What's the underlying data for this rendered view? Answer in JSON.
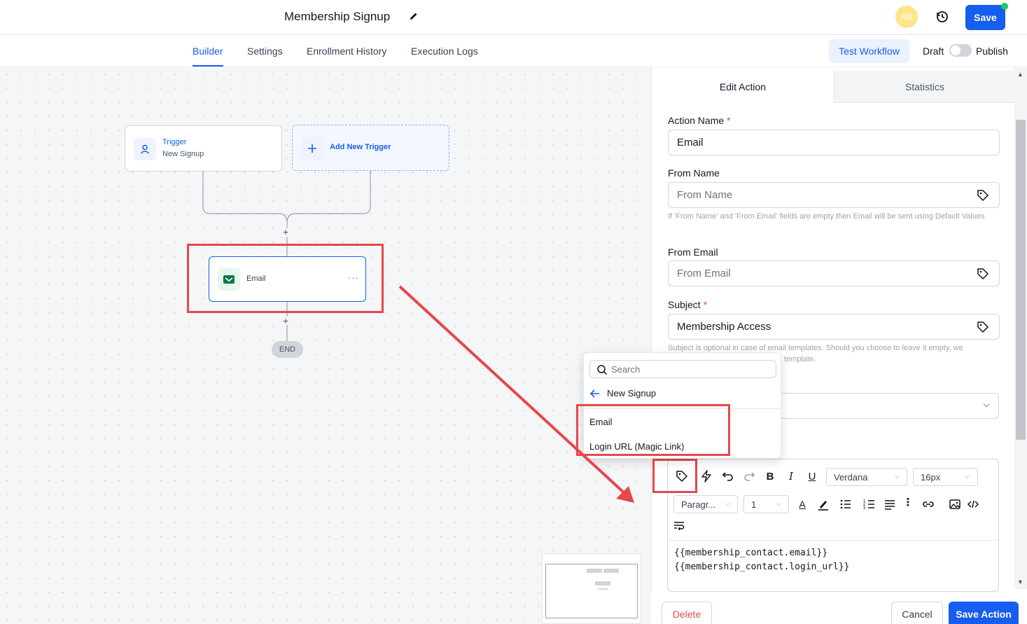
{
  "header": {
    "title": "Membership Signup",
    "avatar_initials": "AB",
    "save_label": "Save"
  },
  "tabs": [
    {
      "label": "Builder",
      "active": true
    },
    {
      "label": "Settings",
      "active": false
    },
    {
      "label": "Enrollment History",
      "active": false
    },
    {
      "label": "Execution Logs",
      "active": false
    }
  ],
  "toolbar": {
    "test_label": "Test Workflow",
    "draft_label": "Draft",
    "publish_label": "Publish",
    "publish_enabled": false
  },
  "canvas": {
    "trigger": {
      "title": "Trigger",
      "subtitle": "New Signup"
    },
    "add_trigger": {
      "label": "Add New Trigger"
    },
    "action": {
      "label": "Email"
    },
    "end_label": "END",
    "plus": "+"
  },
  "panel": {
    "tabs": [
      {
        "label": "Edit Action",
        "active": true
      },
      {
        "label": "Statistics",
        "active": false
      }
    ],
    "action_name": {
      "label": "Action Name",
      "value": "Email"
    },
    "from_name": {
      "label": "From Name",
      "placeholder": "From Name",
      "help": "If 'From Name' and 'From Email' fields are empty then Email will be sent using Default Values"
    },
    "from_email": {
      "label": "From Email",
      "placeholder": "From Email"
    },
    "subject": {
      "label": "Subject",
      "value": "Membership Access",
      "help_left": "Subject is optional in case of email templates. Should you choose to leave it empty, we",
      "help_right": "template."
    },
    "editor": {
      "font": "Verdana",
      "size": "16px",
      "block": "Paragr...",
      "line_height": "1",
      "content": [
        "{{membership_contact.email}}",
        "{{membership_contact.login_url}}"
      ]
    },
    "buttons": {
      "delete": "Delete",
      "cancel": "Cancel",
      "save_action": "Save Action"
    }
  },
  "popover": {
    "search_placeholder": "Search",
    "back_label": "New Signup",
    "items": [
      "Email",
      "Login URL (Magic Link)"
    ]
  },
  "colors": {
    "primary": "#155eef",
    "danger": "#e5484d",
    "annotation": "#e5484d",
    "success": "#22c55e"
  }
}
